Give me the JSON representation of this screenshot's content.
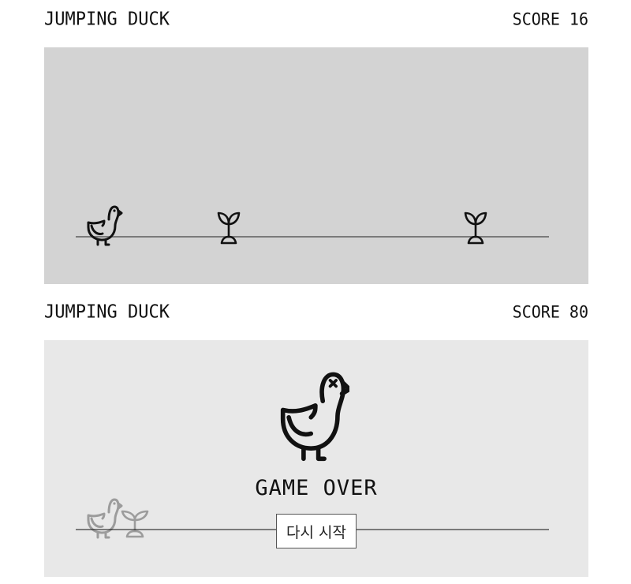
{
  "screen_active": {
    "title": "JUMPING DUCK",
    "score_text": "SCORE 16",
    "duck_icon": "duck-icon",
    "obstacle_icon": "sprout-icon"
  },
  "screen_game_over": {
    "title": "JUMPING DUCK",
    "score_text": "SCORE 80",
    "dead_duck_icon": "dead-duck-icon",
    "game_over_text": "GAME OVER",
    "restart_label": "다시 시작"
  },
  "colors": {
    "active_background": "#d3d3d3",
    "game_over_background": "#e8e8e8",
    "ground_line": "#7a7a7a",
    "ink": "#111111"
  }
}
